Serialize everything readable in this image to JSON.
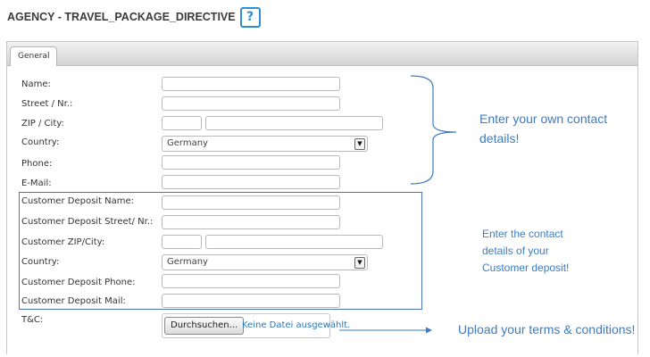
{
  "header": {
    "title": "AGENCY - TRAVEL_PACKAGE_DIRECTIVE",
    "help_glyph": "?"
  },
  "tabs": [
    {
      "label": "General"
    }
  ],
  "form": {
    "own_fields": [
      {
        "label": "Name:"
      },
      {
        "label": "Street / Nr.:"
      },
      {
        "label": "ZIP / City:"
      },
      {
        "label": "Country:",
        "value": "Germany"
      },
      {
        "label": "Phone:"
      },
      {
        "label": "E-Mail:"
      }
    ],
    "deposit_fields": [
      {
        "label": "Customer Deposit Name:"
      },
      {
        "label": "Customer Deposit Street/ Nr.:"
      },
      {
        "label": "Customer ZIP/City:"
      },
      {
        "label": "Country:",
        "value": "Germany"
      },
      {
        "label": "Customer Deposit Phone:"
      },
      {
        "label": "Customer Deposit Mail:"
      }
    ],
    "tnc": {
      "label": "T&C:",
      "button_label": "Durchsuchen...",
      "file_status": "Keine Datei ausgewählt."
    }
  },
  "annotations": {
    "own_contact": [
      "Enter your own contact",
      "details!"
    ],
    "deposit_contact": [
      "Enter the contact",
      "details of your",
      "Customer deposit!"
    ],
    "upload": "Upload your terms & conditions!"
  },
  "colors": {
    "accent": "#2e8fd6",
    "annotation_text": "#3b7cc4",
    "deposit_border": "#4b74b8",
    "file_status": "#2e75b6"
  },
  "icons": {
    "help": "help-icon",
    "dropdown": "chevron-down-icon",
    "arrow": "arrow-right-icon"
  }
}
